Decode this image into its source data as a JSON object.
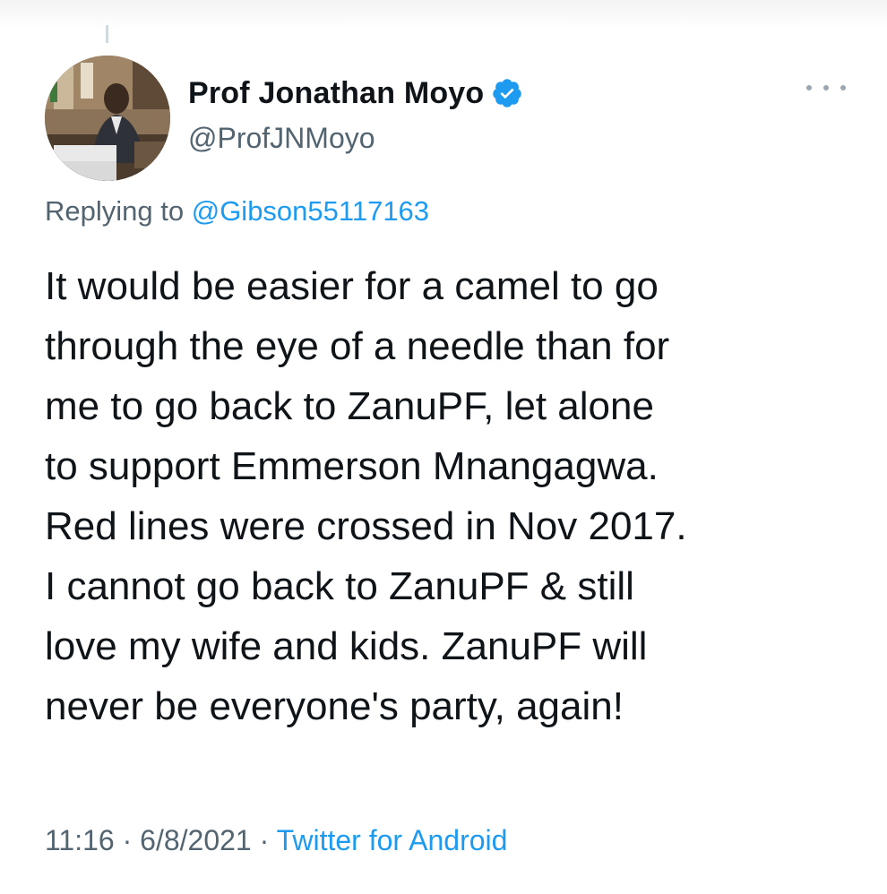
{
  "tweet": {
    "author": {
      "display_name": "Prof Jonathan Moyo",
      "handle": "@ProfJNMoyo",
      "verified": true
    },
    "replying_to_prefix": "Replying to",
    "replying_to_handle": "@Gibson55117163",
    "text": "It would be easier for a camel to go\nthrough the eye of a needle than for\nme to go back to ZanuPF, let alone\nto support Emmerson Mnangagwa.\nRed lines were crossed in Nov 2017.\nI cannot go back to ZanuPF & still\nlove my wife and kids. ZanuPF will\nnever be everyone's party, again!",
    "time": "11:16",
    "date": "6/8/2021",
    "separator": "·",
    "source": "Twitter for Android"
  },
  "colors": {
    "text": "#0f1419",
    "secondary": "#536471",
    "accent": "#1d9bf0"
  },
  "icons": {
    "verified": "verified-badge-icon",
    "more": "more-options-icon"
  }
}
